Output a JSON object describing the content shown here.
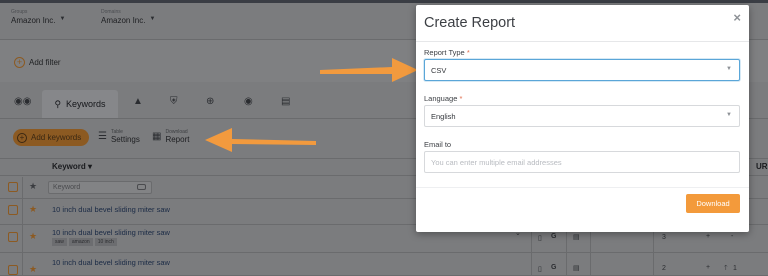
{
  "header": {
    "group_caption": "Groups",
    "group_value": "Amazon Inc.",
    "domain_caption": "Domains",
    "domain_value": "Amazon Inc."
  },
  "filter": {
    "add_filter_label": "Add filter"
  },
  "tabs": {
    "active_label": "Keywords"
  },
  "toolbar": {
    "add_keywords_label": "Add keywords",
    "table_settings_small": "Table",
    "table_settings_label": "Settings",
    "download_report_small": "Download",
    "download_report_label": "Report"
  },
  "table": {
    "keyword_header": "Keyword",
    "url_header": "UR",
    "filter_placeholder": "Keyword",
    "rows": [
      {
        "keyword": "10 inch dual bevel sliding miter saw"
      },
      {
        "keyword": "10 inch dual bevel sliding miter saw",
        "tags": [
          "saw",
          "amazon",
          "10 inch"
        ],
        "pos": "3",
        "plus": "+",
        "dash": "-"
      },
      {
        "keyword": "10 inch dual bevel sliding miter saw",
        "pos": "2",
        "plus": "+",
        "delta": "1"
      }
    ]
  },
  "modal": {
    "title": "Create Report",
    "close_symbol": "×",
    "report_type_label": "Report Type",
    "report_type_value": "CSV",
    "language_label": "Language",
    "language_value": "English",
    "email_label": "Email to",
    "email_placeholder": "You can enter multiple email addresses",
    "required_mark": "*",
    "download_label": "Download"
  },
  "colors": {
    "accent_orange": "#f39a3b",
    "focus_blue": "#5aa6d8",
    "arrow_orange": "#f29a3e"
  }
}
